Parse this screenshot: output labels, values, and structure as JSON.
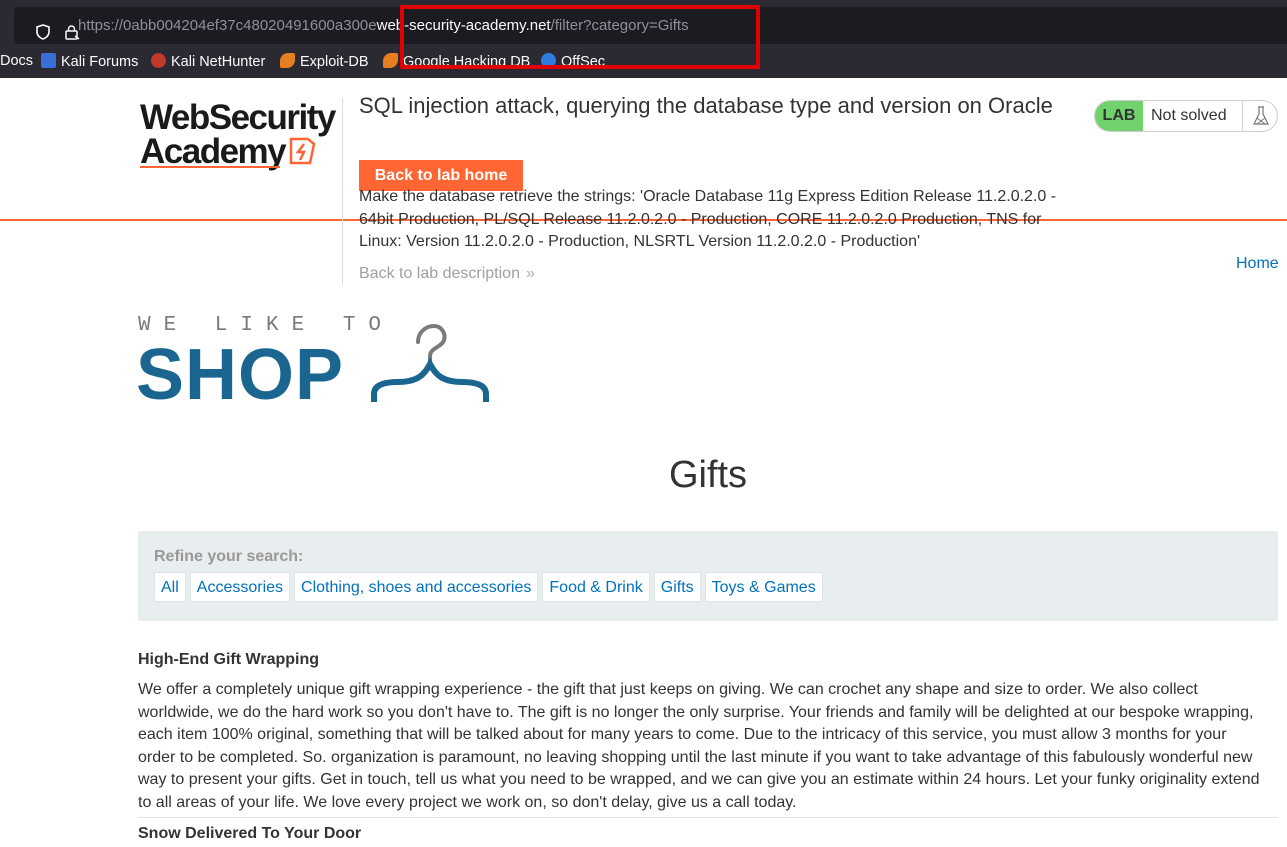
{
  "browser": {
    "url_prefix": "https://0abb004204ef37c48020491600a300e",
    "url_host": "web-security-academy.net",
    "url_path": "/filter?category=Gifts",
    "bookmarks": [
      {
        "label": "Docs"
      },
      {
        "label": "Kali Forums"
      },
      {
        "label": "Kali NetHunter"
      },
      {
        "label": "Exploit-DB"
      },
      {
        "label": "Google Hacking DB"
      },
      {
        "label": "OffSec"
      }
    ],
    "highlight_color": "#e00000"
  },
  "lab_header": {
    "logo_line1": "WebSecurity",
    "logo_line2": "Academy",
    "title": "SQL injection attack, querying the database type and version on Oracle",
    "back_home": "Back to lab home",
    "description": "Make the database retrieve the strings: 'Oracle Database 11g Express Edition Release 11.2.0.2.0 - 64bit Production, PL/SQL Release 11.2.0.2.0 - Production, CORE 11.2.0.2.0 Production, TNS for Linux: Version 11.2.0.2.0 - Production, NLSRTL Version 11.2.0.2.0 - Production'",
    "back_description": "Back to lab description",
    "badge_label": "LAB",
    "badge_status": "Not solved",
    "accent": "#ff6633",
    "badge_color": "#70d16d"
  },
  "nav": {
    "home": "Home"
  },
  "shop": {
    "tagline": "WE LIKE TO",
    "name": "SHOP",
    "brand_color": "#1a6690"
  },
  "page": {
    "heading": "Gifts"
  },
  "filter": {
    "label": "Refine your search:",
    "categories": [
      "All",
      "Accessories",
      "Clothing, shoes and accessories",
      "Food & Drink",
      "Gifts",
      "Toys & Games"
    ]
  },
  "products": [
    {
      "name": "High-End Gift Wrapping",
      "description": "We offer a completely unique gift wrapping experience - the gift that just keeps on giving. We can crochet any shape and size to order. We also collect worldwide, we do the hard work so you don't have to. The gift is no longer the only surprise. Your friends and family will be delighted at our bespoke wrapping, each item 100% original, something that will be talked about for many years to come. Due to the intricacy of this service, you must allow 3 months for your order to be completed. So. organization is paramount, no leaving shopping until the last minute if you want to take advantage of this fabulously wonderful new way to present your gifts. Get in touch, tell us what you need to be wrapped, and we can give you an estimate within 24 hours. Let your funky originality extend to all areas of your life. We love every project we work on, so don't delay, give us a call today."
    },
    {
      "name": "Snow Delivered To Your Door"
    }
  ]
}
